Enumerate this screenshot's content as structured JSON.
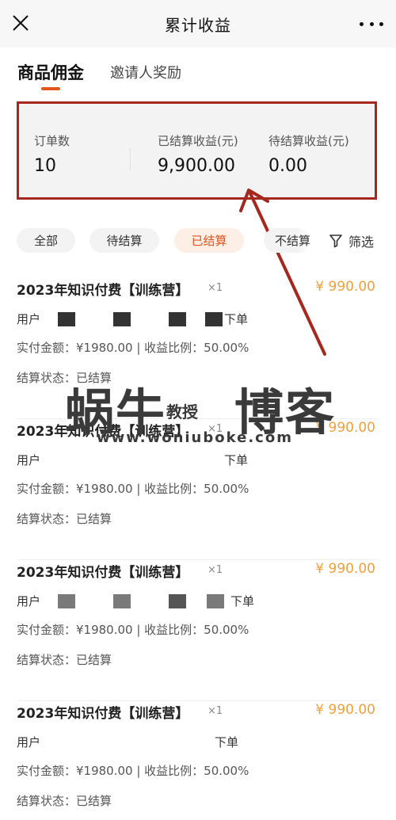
{
  "header": {
    "title": "累计收益",
    "close_icon": "close-icon",
    "more_icon": "more-icon"
  },
  "tabs": [
    {
      "label": "商品佣金",
      "active": true
    },
    {
      "label": "邀请人奖励",
      "active": false
    }
  ],
  "summary": {
    "order_count_label": "订单数",
    "order_count_value": "10",
    "settled_label": "已结算收益(元)",
    "settled_value": "9,900.00",
    "pending_label": "待结算收益(元)",
    "pending_value": "0.00"
  },
  "filters": {
    "chips": [
      {
        "label": "全部",
        "active": false
      },
      {
        "label": "待结算",
        "active": false
      },
      {
        "label": "已结算",
        "active": true
      },
      {
        "label": "不结算",
        "active": false
      }
    ],
    "filter_label": "筛选",
    "filter_icon": "funnel-icon"
  },
  "orders": [
    {
      "title": "2023年知识付费【训练营】",
      "qty": "×1",
      "amount": "¥ 990.00",
      "user_label": "用户",
      "user_suffix": "下单",
      "detail": "实付金额：¥1980.00 | 收益比例：50.00%",
      "status": "结算状态：已结算"
    },
    {
      "title": "2023年知识付费【训练营】",
      "qty": "×1",
      "amount": "¥ 990.00",
      "user_label": "用户",
      "user_suffix": "下单",
      "detail": "实付金额：¥1980.00 | 收益比例：50.00%",
      "status": "结算状态：已结算"
    },
    {
      "title": "2023年知识付费【训练营】",
      "qty": "×1",
      "amount": "¥ 990.00",
      "user_label": "用户",
      "user_suffix": "下单",
      "detail": "实付金额：¥1980.00 | 收益比例：50.00%",
      "status": "结算状态：已结算"
    },
    {
      "title": "2023年知识付费【训练营】",
      "qty": "×1",
      "amount": "¥ 990.00",
      "user_label": "用户",
      "user_suffix": "下单",
      "detail": "实付金额：¥1980.00 | 收益比例：50.00%",
      "status": "结算状态：已结算"
    }
  ],
  "watermark": {
    "left": "蜗牛",
    "small": "教授",
    "right": "博客",
    "url": "www.woniuboke.com"
  },
  "colors": {
    "accent": "#e2551e",
    "highlight_border": "#a5281f",
    "amount": "#f0a03c"
  }
}
